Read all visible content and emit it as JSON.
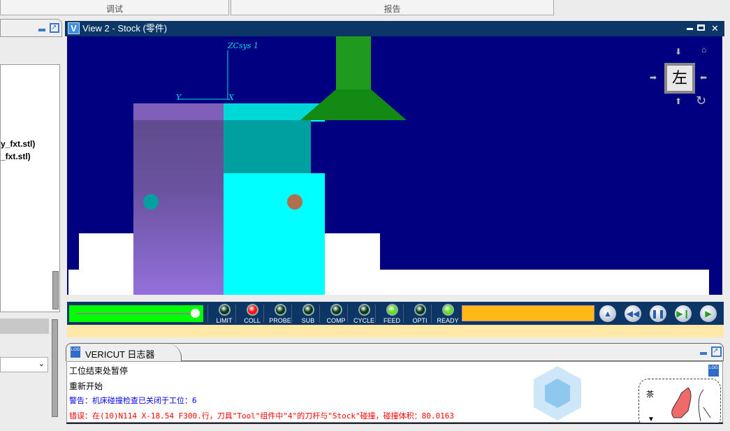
{
  "top_tabs": [
    "调试",
    "报告"
  ],
  "left_panel": {
    "files": [
      "y_fxt.stl)",
      "_fxt.stl)"
    ]
  },
  "view": {
    "title": "View 2 - Stock (零件)",
    "axis_label": "ZCsys 1",
    "axis_y": "Y",
    "axis_x": "X",
    "view_cube_label": "左"
  },
  "indicators": [
    {
      "label": "LIMIT",
      "color": "#0a3a1a"
    },
    {
      "label": "COLL",
      "color": "#ff1010"
    },
    {
      "label": "PROBE",
      "color": "#0a3a1a"
    },
    {
      "label": "SUB",
      "color": "#0a3a1a"
    },
    {
      "label": "COMP",
      "color": "#0a3a1a"
    },
    {
      "label": "CYCLE",
      "color": "#0a3a1a"
    },
    {
      "label": "FEED",
      "color": "#60e020"
    },
    {
      "label": "OPTI",
      "color": "#0a3a1a"
    },
    {
      "label": "READY",
      "color": "#60e020"
    }
  ],
  "speed_slider": {
    "value_percent": 100
  },
  "progress_color": "#ffb914",
  "playback": [
    "eject",
    "rewind",
    "pause",
    "step",
    "play"
  ],
  "log": {
    "tab_label": "VERICUT 日志器",
    "icon_text": "LOG",
    "lines": [
      {
        "text": "工位结束处暂停",
        "color": "#000000"
      },
      {
        "text": "重新开始",
        "color": "#000000"
      },
      {
        "text": "警告：机床碰撞检查已关闭于工位：6",
        "color": "#0000ff"
      },
      {
        "text": "错误：在(10)N114 X-18.54 F300.行，刀具\"Tool\"组件中\"4\"的刀杆与\"Stock\"碰撞，碰撞体积：80.0163",
        "color": "#ff0000"
      }
    ]
  }
}
